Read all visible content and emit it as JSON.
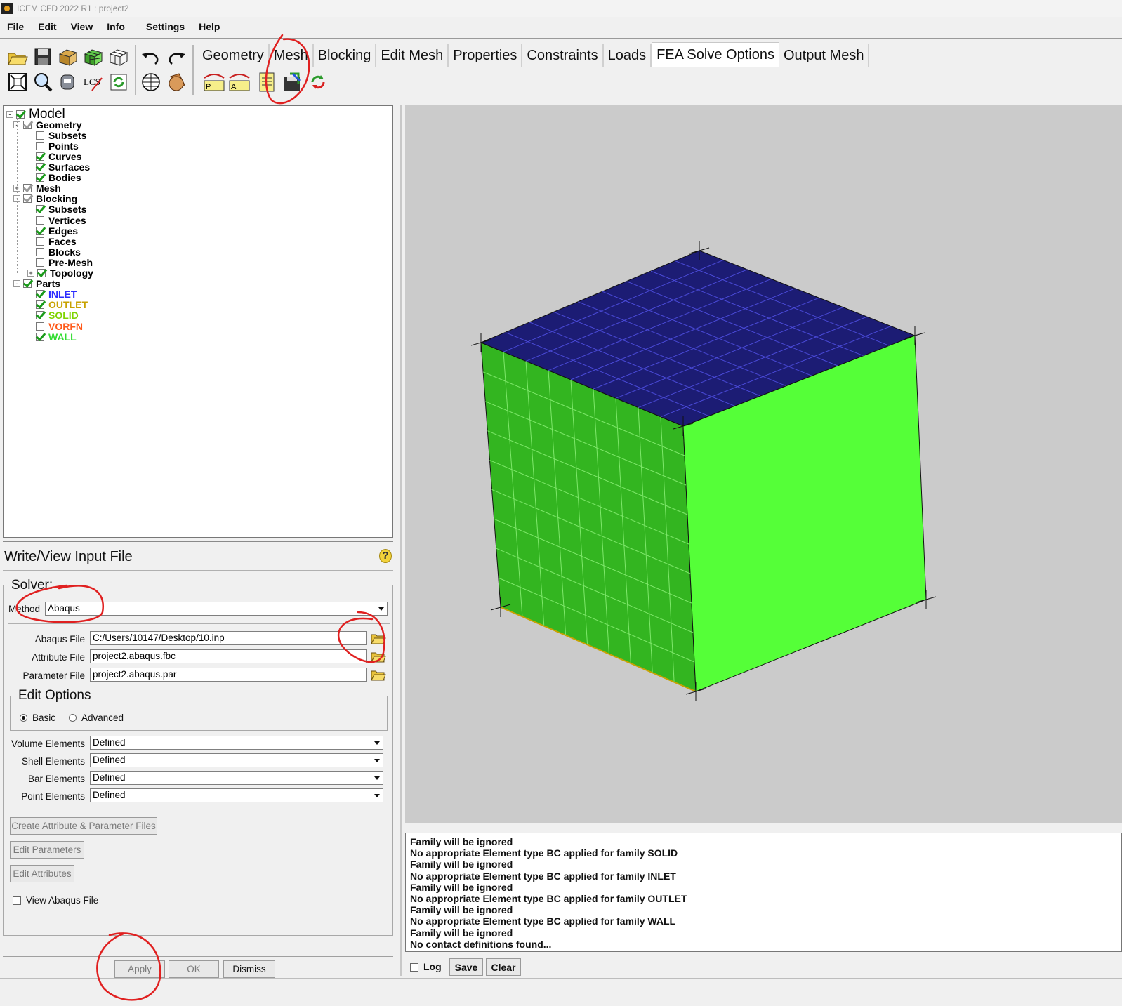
{
  "window": {
    "title": "ICEM CFD 2022 R1 : project2"
  },
  "menu": [
    "File",
    "Edit",
    "View",
    "Info",
    "Settings",
    "Help"
  ],
  "tabs": [
    {
      "label": "Geometry"
    },
    {
      "label": "Mesh"
    },
    {
      "label": "Blocking"
    },
    {
      "label": "Edit Mesh"
    },
    {
      "label": "Properties"
    },
    {
      "label": "Constraints"
    },
    {
      "label": "Loads"
    },
    {
      "label": "FEA Solve Options",
      "active": true
    },
    {
      "label": "Output Mesh"
    }
  ],
  "toolbar": {
    "icons": [
      "open-icon",
      "save-icon",
      "open-geometry-icon",
      "open-mesh-icon",
      "open-blocking-icon",
      "undo-icon",
      "redo-icon",
      "fit-window-icon",
      "zoom-box-icon",
      "measure-icon",
      "local-coordinate-icon",
      "transform-icon",
      "refresh-icon",
      "wireframe-icon",
      "solid-shaded-icon"
    ],
    "lcs_label": "LCS",
    "fea_tool_labels": [
      "P",
      "A"
    ]
  },
  "tree": {
    "items": [
      {
        "label": "Model",
        "level": 0,
        "checked": true,
        "expander": "-",
        "color": "#000000",
        "large": true
      },
      {
        "label": "Geometry",
        "level": 1,
        "checked": true,
        "expander": "-",
        "color": "#000000",
        "gray": true
      },
      {
        "label": "Subsets",
        "level": 2,
        "checked": false,
        "color": "#000000"
      },
      {
        "label": "Points",
        "level": 2,
        "checked": false,
        "color": "#000000"
      },
      {
        "label": "Curves",
        "level": 2,
        "checked": true,
        "color": "#000000"
      },
      {
        "label": "Surfaces",
        "level": 2,
        "checked": true,
        "color": "#000000"
      },
      {
        "label": "Bodies",
        "level": 2,
        "checked": true,
        "color": "#000000"
      },
      {
        "label": "Mesh",
        "level": 1,
        "checked": true,
        "expander": "+",
        "color": "#000000",
        "gray": true
      },
      {
        "label": "Blocking",
        "level": 1,
        "checked": true,
        "expander": "-",
        "color": "#000000",
        "gray": true
      },
      {
        "label": "Subsets",
        "level": 2,
        "checked": true,
        "color": "#000000"
      },
      {
        "label": "Vertices",
        "level": 2,
        "checked": false,
        "color": "#000000"
      },
      {
        "label": "Edges",
        "level": 2,
        "checked": true,
        "color": "#000000"
      },
      {
        "label": "Faces",
        "level": 2,
        "checked": false,
        "color": "#000000"
      },
      {
        "label": "Blocks",
        "level": 2,
        "checked": false,
        "color": "#000000"
      },
      {
        "label": "Pre-Mesh",
        "level": 2,
        "checked": false,
        "color": "#000000"
      },
      {
        "label": "Topology",
        "level": 2,
        "checked": true,
        "expander": "+",
        "color": "#000000"
      },
      {
        "label": "Parts",
        "level": 1,
        "checked": true,
        "expander": "-",
        "color": "#000000"
      },
      {
        "label": "INLET",
        "level": 2,
        "checked": true,
        "color": "#2b2bff"
      },
      {
        "label": "OUTLET",
        "level": 2,
        "checked": true,
        "color": "#c8a200"
      },
      {
        "label": "SOLID",
        "level": 2,
        "checked": true,
        "color": "#7fd400"
      },
      {
        "label": "VORFN",
        "level": 2,
        "checked": false,
        "color": "#ff5a1a"
      },
      {
        "label": "WALL",
        "level": 2,
        "checked": true,
        "color": "#33dd33"
      }
    ]
  },
  "panel": {
    "title": "Write/View Input File",
    "help": "?",
    "solver_label": "Solver:",
    "method_label": "Method",
    "method_value": "Abaqus",
    "files": [
      {
        "label": "Abaqus File",
        "value": "C:/Users/10147/Desktop/10.inp"
      },
      {
        "label": "Attribute File",
        "value": "project2.abaqus.fbc"
      },
      {
        "label": "Parameter File",
        "value": "project2.abaqus.par"
      }
    ],
    "edit_options": {
      "label": "Edit Options",
      "basic": "Basic",
      "advanced": "Advanced",
      "selected": "Basic"
    },
    "elements": [
      {
        "label": "Volume Elements",
        "value": "Defined"
      },
      {
        "label": "Shell Elements",
        "value": "Defined"
      },
      {
        "label": "Bar Elements",
        "value": "Defined"
      },
      {
        "label": "Point Elements",
        "value": "Defined"
      }
    ],
    "create_files_button": "Create Attribute & Parameter Files",
    "edit_parameters_button": "Edit Parameters",
    "edit_attributes_button": "Edit Attributes",
    "view_file_label": "View Abaqus File",
    "view_file_checked": false,
    "apply": "Apply",
    "ok": "OK",
    "dismiss": "Dismiss"
  },
  "viewport": {
    "background": "#cbcbcb",
    "top_face_color": "#1c1c74",
    "left_face_color": "#33b520",
    "right_face_color": "#55ff38",
    "grid_divisions": 9
  },
  "messages": [
    "Family will be ignored",
    "No appropriate Element type BC applied for family SOLID",
    "Family will be ignored",
    "No appropriate Element type BC applied for family INLET",
    "Family will be ignored",
    "No appropriate Element type BC applied for family OUTLET",
    "Family will be ignored",
    "No appropriate Element type BC applied for family WALL",
    "Family will be ignored",
    "No contact definitions found..."
  ],
  "message_bar": {
    "log": "Log",
    "log_checked": false,
    "save": "Save",
    "clear": "Clear"
  }
}
